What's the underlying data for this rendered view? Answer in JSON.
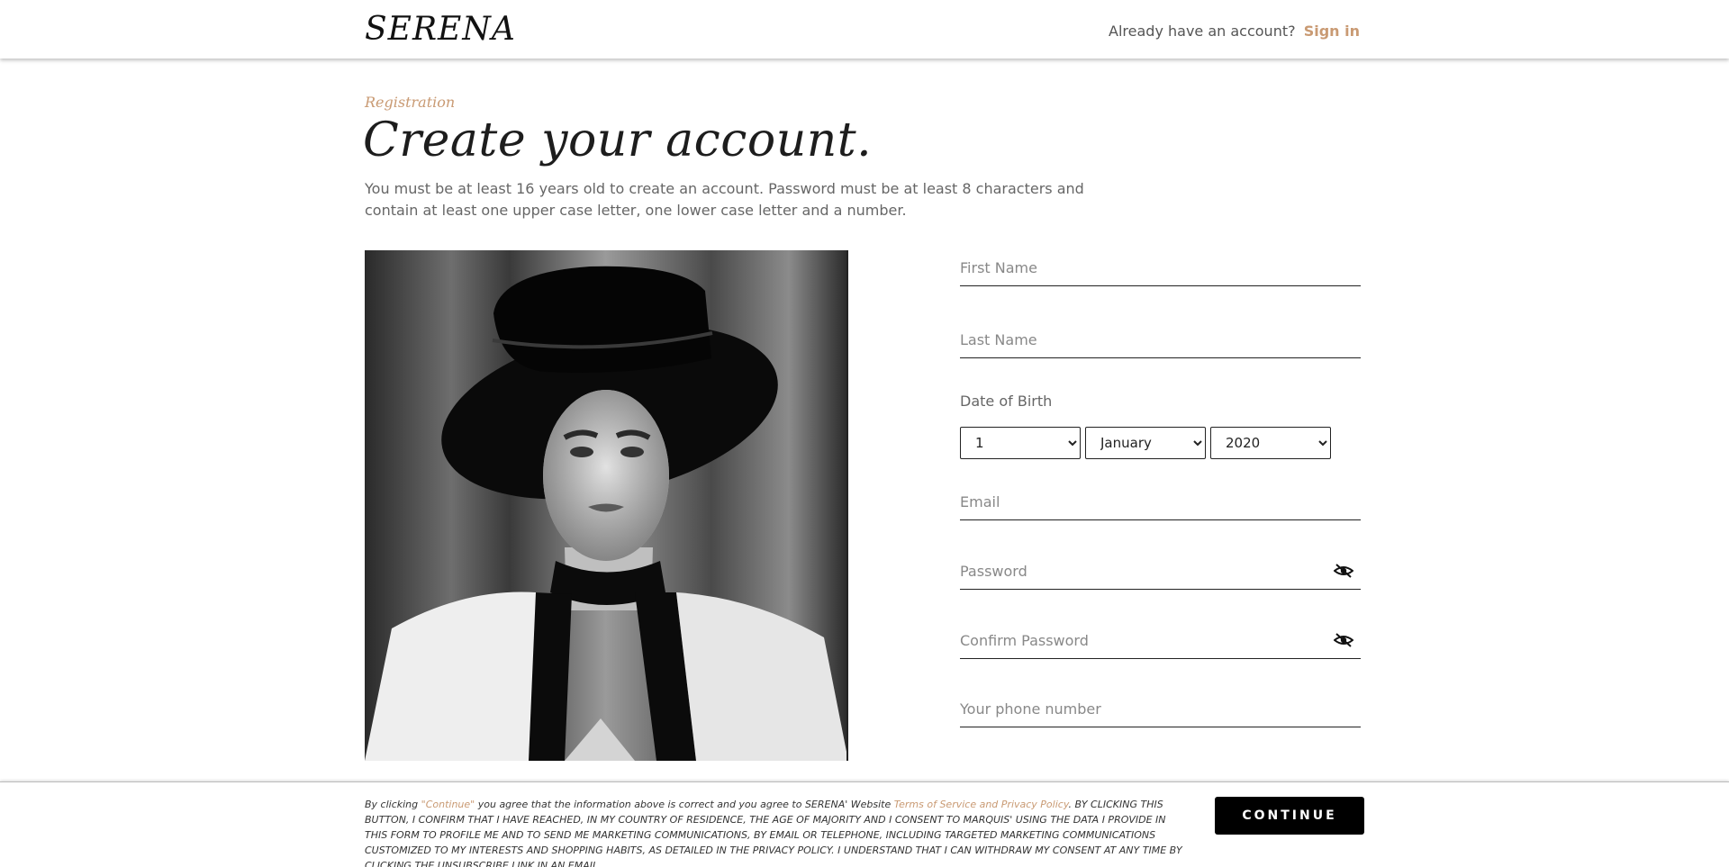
{
  "header": {
    "logo": "SERENA",
    "signin_prompt": "Already have an account?",
    "signin_label": "Sign in"
  },
  "main": {
    "eyebrow": "Registration",
    "title": "Create your account.",
    "intro": "You must be at least 16 years old to create an account. Password must be at least 8 characters and contain at least one upper case letter, one lower case letter and a number."
  },
  "form": {
    "first_name_placeholder": "First Name",
    "last_name_placeholder": "Last Name",
    "dob_label": "Date of Birth",
    "dob_day": "1",
    "dob_month": "January",
    "dob_year": "2020",
    "email_placeholder": "Email",
    "password_placeholder": "Password",
    "confirm_password_placeholder": "Confirm Password",
    "phone_placeholder": "Your phone number",
    "password_toggle_icon": "eye-slash-icon"
  },
  "footer": {
    "legal_1": "By clicking ",
    "legal_continue": "\"Continue\"",
    "legal_2": " you agree that the information above is correct and you agree to SERENA' Website ",
    "legal_terms": "Terms of Service and Privacy Policy",
    "legal_3": ". BY CLICKING THIS BUTTON, I CONFIRM THAT I HAVE REACHED, IN MY COUNTRY OF RESIDENCE, THE AGE OF MAJORITY AND I CONSENT TO MARQUIS' USING THE DATA I PROVIDE IN THIS FORM TO PROFILE ME AND TO SEND ME MARKETING COMMUNICATIONS, BY EMAIL OR TELEPHONE, INCLUDING TARGETED MARKETING COMMUNICATIONS CUSTOMIZED TO MY INTERESTS AND SHOPPING HABITS, AS DETAILED IN THE PRIVACY POLICY. I UNDERSTAND THAT I CAN WITHDRAW MY CONSENT AT ANY TIME BY CLICKING THE UNSUBSCRIBE LINK IN AN EMAIL.",
    "continue_label": "CONTINUE"
  },
  "colors": {
    "accent": "#c99a73",
    "button": "#000000"
  }
}
